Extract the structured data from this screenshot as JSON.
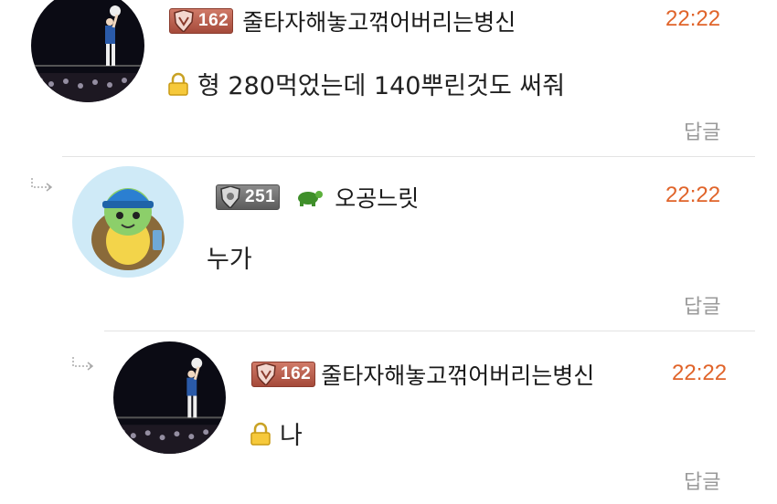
{
  "comments": [
    {
      "level_badge": "162",
      "nickname": "줄타자해놓고꺾어버리는병신",
      "time": "22:22",
      "text": "형 280먹었는데 140뿌린것도 써줘",
      "locked": true,
      "reply_label": "답글"
    },
    {
      "level_badge": "251",
      "nickname": "오공느릿",
      "time": "22:22",
      "text": "누가",
      "locked": false,
      "reply_label": "답글"
    },
    {
      "level_badge": "162",
      "nickname": "줄타자해놓고꺾어버리는병신",
      "time": "22:22",
      "text": "나",
      "locked": true,
      "reply_label": "답글"
    }
  ],
  "icons": {
    "lock": "lock-icon",
    "reply_arrow": "reply-arrow-icon",
    "turtle": "turtle-icon",
    "level_shield": "level-shield-icon"
  },
  "colors": {
    "time": "#e0642a",
    "reply": "#9a9a9a",
    "badge_red": "#b5513f",
    "badge_gray": "#6b6b6b"
  }
}
